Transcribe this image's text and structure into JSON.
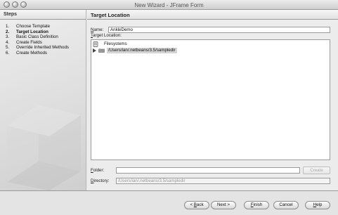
{
  "window": {
    "title": "New Wizard - JFrame Form"
  },
  "steps": {
    "heading": "Steps",
    "items": [
      {
        "num": "1.",
        "label": "Choose Template"
      },
      {
        "num": "2.",
        "label": "Target Location"
      },
      {
        "num": "3.",
        "label": "Basic Class Definition"
      },
      {
        "num": "4.",
        "label": "Create Fields"
      },
      {
        "num": "5.",
        "label": "Override Inherited Methods"
      },
      {
        "num": "6.",
        "label": "Create Methods"
      }
    ],
    "active_index": 1
  },
  "main": {
    "heading": "Target Location",
    "name_label_mnemonic": "N",
    "name_label_rest": "ame:",
    "name_value": "AnkleDemo",
    "target_label_first": "T",
    "target_label_rest": "arget Location:",
    "tree": [
      {
        "label": "Filesystems",
        "icon": "filesystems-icon"
      },
      {
        "label": "/Users/ian/.netbeans/3.5/sampledir",
        "icon": "folder-icon",
        "selected": true
      }
    ],
    "folder_label_mnemonic": "F",
    "folder_label_rest": "older:",
    "folder_value": "",
    "create_button": "Create",
    "directory_label_mnemonic": "D",
    "directory_label_rest": "irectory:",
    "directory_value": "/Users/ian/.netbeans/3.5/sampledir"
  },
  "buttons": {
    "back_mnemonic": "B",
    "back_prefix": "< ",
    "back_rest": "ack",
    "next": "Next >",
    "finish_mnemonic": "F",
    "finish_rest": "inish",
    "cancel": "Cancel",
    "help_mnemonic": "H",
    "help_rest": "elp"
  }
}
